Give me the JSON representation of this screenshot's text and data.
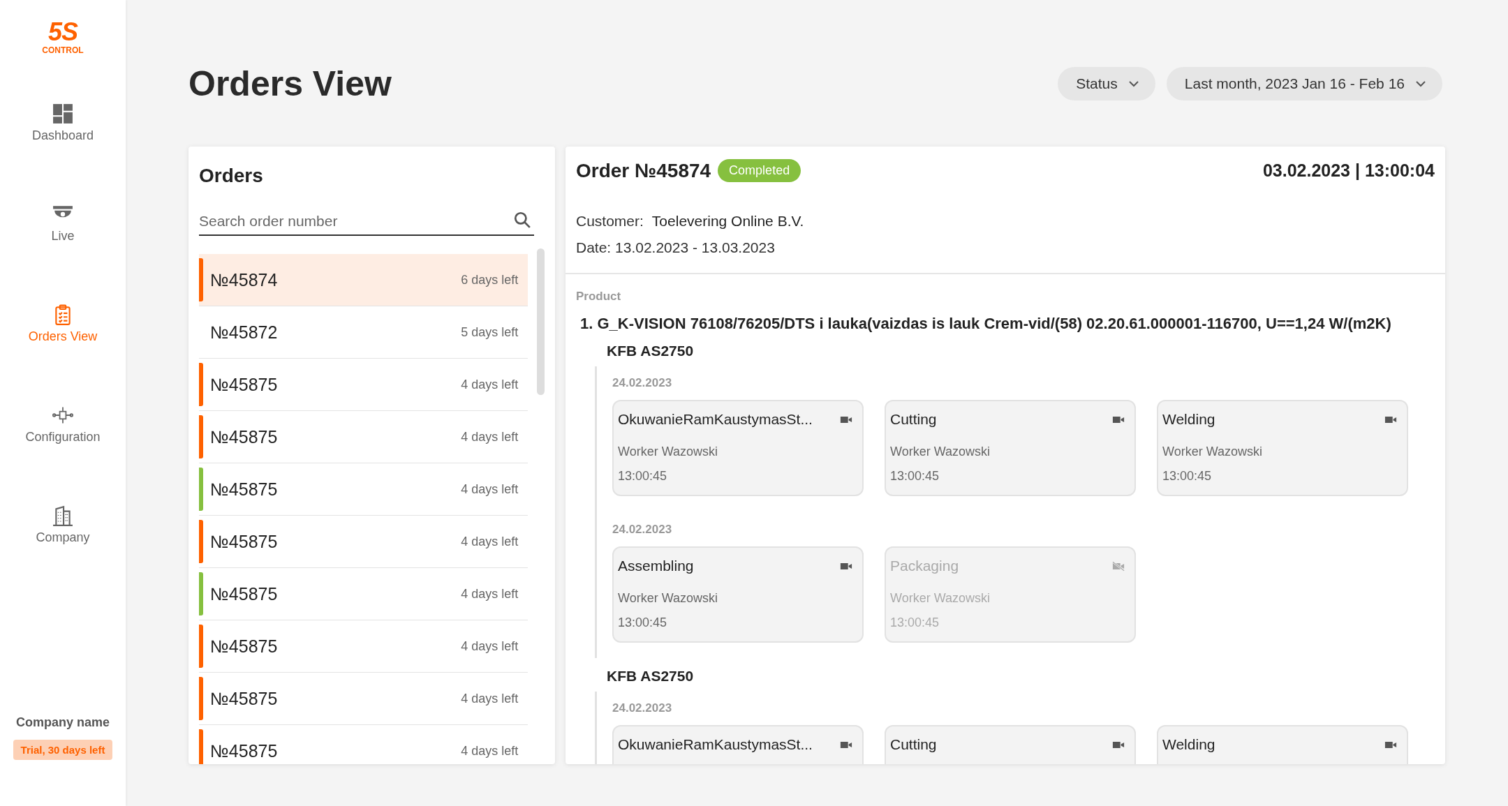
{
  "logo": {
    "mark": "5S",
    "caption": "CONTROL"
  },
  "sidebar": {
    "items": [
      {
        "label": "Dashboard",
        "kind": "dashboard",
        "selected": false
      },
      {
        "label": "Live",
        "kind": "live",
        "selected": false
      },
      {
        "label": "Orders View",
        "kind": "orders",
        "selected": true
      },
      {
        "label": "Configuration",
        "kind": "configuration",
        "selected": false
      },
      {
        "label": "Company",
        "kind": "company",
        "selected": false
      }
    ],
    "company_name": "Company name",
    "trial_badge": "Trial, 30 days left"
  },
  "page_title": "Orders View",
  "filters": [
    {
      "label": "Status"
    },
    {
      "label": "Last month, 2023 Jan 16 - Feb 16"
    }
  ],
  "orders": {
    "title": "Orders",
    "search": {
      "placeholder": "Search order number"
    },
    "items": [
      {
        "number": "№45874",
        "remaining": "6 days left",
        "selected": true,
        "color": "#fe6100"
      },
      {
        "number": "№45872",
        "remaining": "5 days left",
        "selected": false
      },
      {
        "number": "№45875",
        "remaining": "4 days left",
        "selected": false,
        "color": "#fe6100"
      },
      {
        "number": "№45875",
        "remaining": "4 days left",
        "selected": false,
        "color": "#fe6100"
      },
      {
        "number": "№45875",
        "remaining": "4 days left",
        "selected": false,
        "color": "#86c03f"
      },
      {
        "number": "№45875",
        "remaining": "4 days left",
        "selected": false,
        "color": "#fe6100"
      },
      {
        "number": "№45875",
        "remaining": "4 days left",
        "selected": false,
        "color": "#86c03f"
      },
      {
        "number": "№45875",
        "remaining": "4 days left",
        "selected": false,
        "color": "#fe6100"
      },
      {
        "number": "№45875",
        "remaining": "4 days left",
        "selected": false,
        "color": "#fe6100"
      },
      {
        "number": "№45875",
        "remaining": "4 days left",
        "selected": false,
        "color": "#fe6100"
      }
    ]
  },
  "order": {
    "title": "Order №45874",
    "status": "Completed",
    "timestamp": "03.02.2023 | 13:00:04",
    "customer_label": "Customer:",
    "customer": "Toelevering Online B.V.",
    "date": "Date: 13.02.2023 - 13.03.2023",
    "product_label": "Product",
    "products": [
      {
        "name": "1. G_K-VISION 76108/76205/DTS i lauka(vaizdas is lauk Crem-vid/(58) 02.20.61.000001-116700, U==1,24 W/(m2K)",
        "groups": [
          {
            "name": "KFB AS2750",
            "days": [
              {
                "date": "24.02.2023",
                "stages": [
                  {
                    "name": "OkuwanieRamKaustymasSt...",
                    "worker": "Worker Wazowski",
                    "time": "13:00:45",
                    "disabled": false
                  },
                  {
                    "name": "Cutting",
                    "worker": "Worker Wazowski",
                    "time": "13:00:45",
                    "disabled": false
                  },
                  {
                    "name": "Welding",
                    "worker": "Worker Wazowski",
                    "time": "13:00:45",
                    "disabled": false
                  }
                ]
              },
              {
                "date": "24.02.2023",
                "stages": [
                  {
                    "name": "Assembling",
                    "worker": "Worker Wazowski",
                    "time": "13:00:45",
                    "disabled": false
                  },
                  {
                    "name": "Packaging",
                    "worker": "Worker Wazowski",
                    "time": "13:00:45",
                    "disabled": true
                  }
                ]
              }
            ]
          },
          {
            "name": "KFB AS2750",
            "days": [
              {
                "date": "24.02.2023",
                "stages": [
                  {
                    "name": "OkuwanieRamKaustymasSt...",
                    "disabled": false
                  },
                  {
                    "name": "Cutting",
                    "disabled": false
                  },
                  {
                    "name": "Welding",
                    "disabled": false
                  }
                ]
              }
            ]
          }
        ]
      }
    ]
  }
}
